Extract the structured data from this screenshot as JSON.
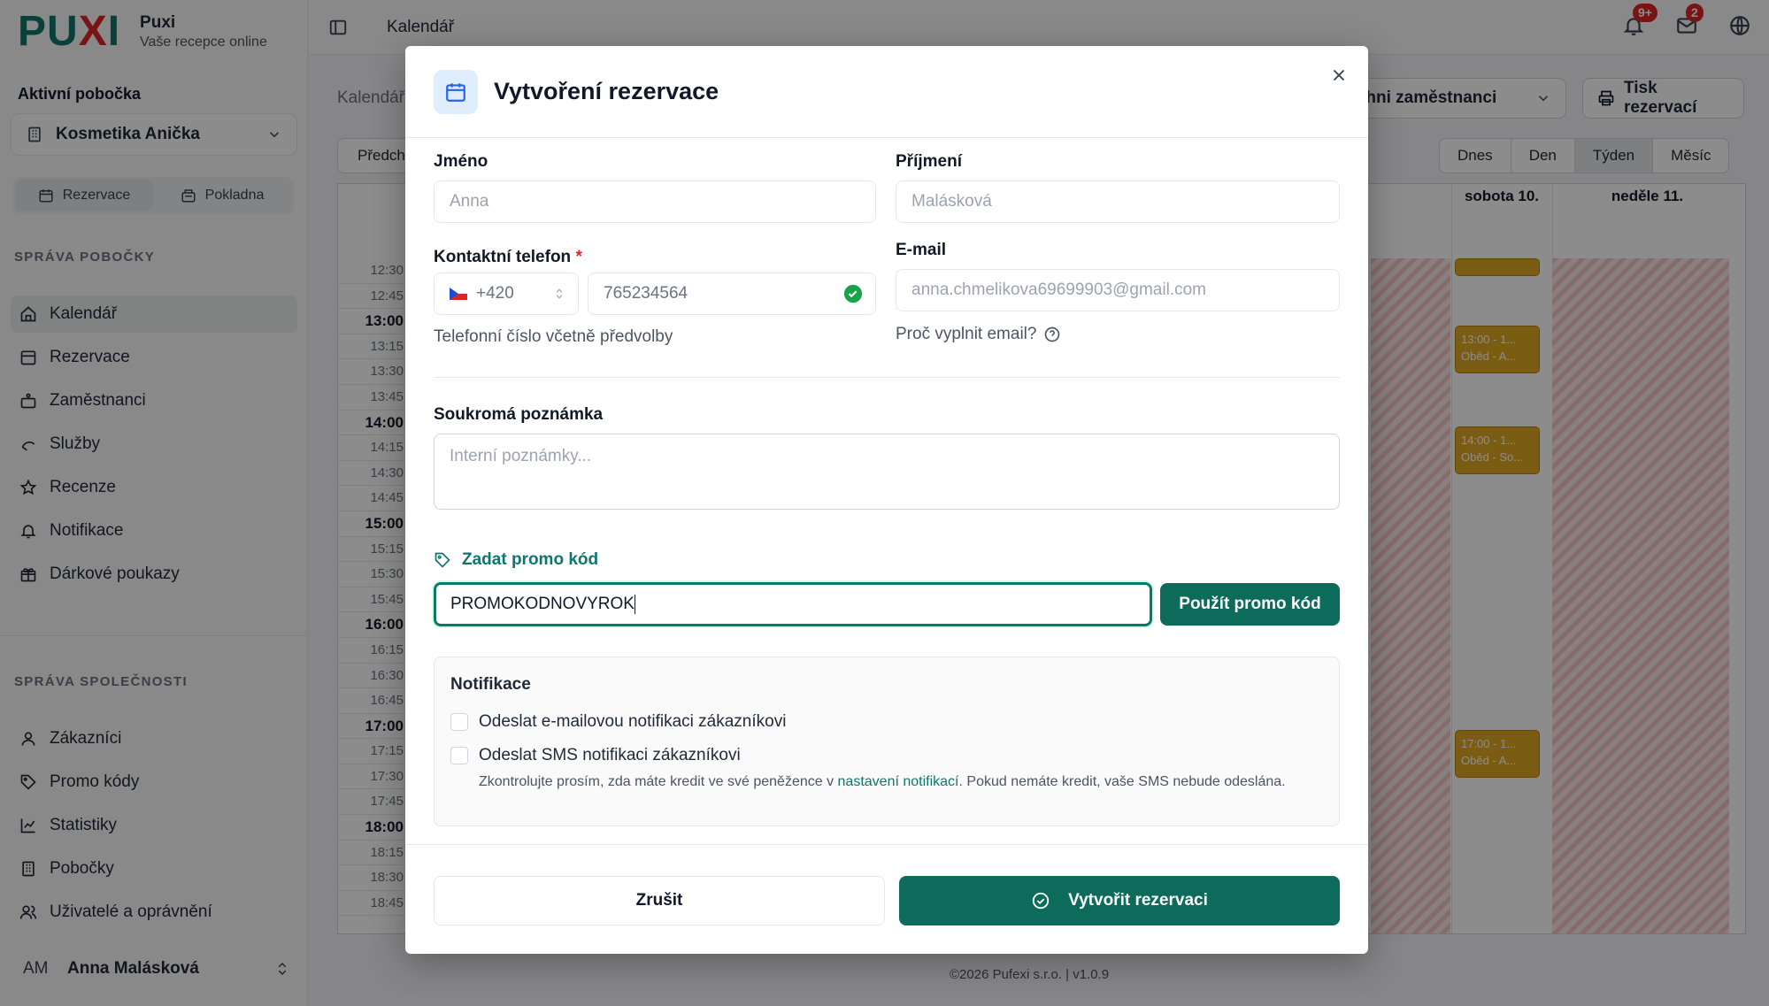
{
  "brand": {
    "logo_a": "PU",
    "logo_x": "X",
    "logo_b": "I",
    "name": "Puxi",
    "subtitle": "Vaše recepce online"
  },
  "sidebar": {
    "branch_label": "Aktivní pobočka",
    "branch_value": "Kosmetika Anička",
    "switch": [
      {
        "label": "Rezervace"
      },
      {
        "label": "Pokladna"
      }
    ],
    "group1_title": "SPRÁVA POBOČKY",
    "group1": [
      {
        "label": "Kalendář",
        "icon": "home-icon"
      },
      {
        "label": "Rezervace",
        "icon": "calendar-icon"
      },
      {
        "label": "Zaměstnanci",
        "icon": "staff-icon"
      },
      {
        "label": "Služby",
        "icon": "service-icon"
      },
      {
        "label": "Recenze",
        "icon": "star-icon"
      },
      {
        "label": "Notifikace",
        "icon": "bell-icon"
      },
      {
        "label": "Dárkové poukazy",
        "icon": "gift-icon"
      }
    ],
    "group2_title": "SPRÁVA SPOLEČNOSTI",
    "group2": [
      {
        "label": "Zákazníci",
        "icon": "user-icon"
      },
      {
        "label": "Promo kódy",
        "icon": "tag-icon"
      },
      {
        "label": "Statistiky",
        "icon": "chart-icon"
      },
      {
        "label": "Pobočky",
        "icon": "building-icon"
      },
      {
        "label": "Uživatelé a oprávnění",
        "icon": "users-icon"
      }
    ],
    "user_initials": "AM",
    "user_name": "Anna Malásková"
  },
  "topbar": {
    "title": "Kalendář",
    "notif_badge": "9+",
    "mail_badge": "2"
  },
  "calendar": {
    "crumb": "Kalendář",
    "employees": "šichni zaměstnanci",
    "print": "Tisk rezervací",
    "prev": "Předch",
    "views": [
      "Dnes",
      "Den",
      "Týden",
      "Měsíc"
    ],
    "days": [
      "sobota 10.",
      "neděle 11."
    ],
    "times": [
      "12:30",
      "12:45",
      "13:00",
      "13:15",
      "13:30",
      "13:45",
      "14:00",
      "14:15",
      "14:30",
      "14:45",
      "15:00",
      "15:15",
      "15:30",
      "15:45",
      "16:00",
      "16:15",
      "16:30",
      "16:45",
      "17:00",
      "17:15",
      "17:30",
      "17:45",
      "18:00",
      "18:15",
      "18:30",
      "18:45"
    ],
    "events": [
      {
        "time": "13:00 - 1...",
        "name": "Oběd - A..."
      },
      {
        "time": "14:00 - 1...",
        "name": "Oběd - So..."
      },
      {
        "time": "17:00 - 1...",
        "name": "Oběd - A..."
      }
    ]
  },
  "modal": {
    "title": "Vytvoření rezervace",
    "first_name_label": "Jméno",
    "first_name_placeholder": "Anna",
    "last_name_label": "Příjmení",
    "last_name_placeholder": "Malásková",
    "phone_label": "Kontaktní telefon",
    "phone_required": "*",
    "phone_prefix": "+420",
    "phone_value": "765234564",
    "phone_hint": "Telefonní číslo včetně předvolby",
    "email_label": "E-mail",
    "email_placeholder": "anna.chmelikova69699903@gmail.com",
    "email_why": "Proč vyplnit email?",
    "note_label": "Soukromá poznámka",
    "note_placeholder": "Interní poznámky...",
    "promo_link": "Zadat promo kód",
    "promo_value": "PROMOKODNOVYROK",
    "promo_button": "Použít promo kód",
    "notif_title": "Notifikace",
    "notif_email": "Odeslat e-mailovou notifikaci zákazníkovi",
    "notif_sms": "Odeslat SMS notifikaci zákazníkovi",
    "notif_note_a": "Zkontrolujte prosím, zda máte kredit ve své peněžence v ",
    "notif_note_link": "nastavení notifikací",
    "notif_note_b": ". Pokud nemáte kredit, vaše SMS nebude odeslána.",
    "cancel": "Zrušit",
    "create": "Vytvořit rezervaci"
  },
  "footer": "©2026 Pufexi s.r.o.  |  v1.0.9"
}
